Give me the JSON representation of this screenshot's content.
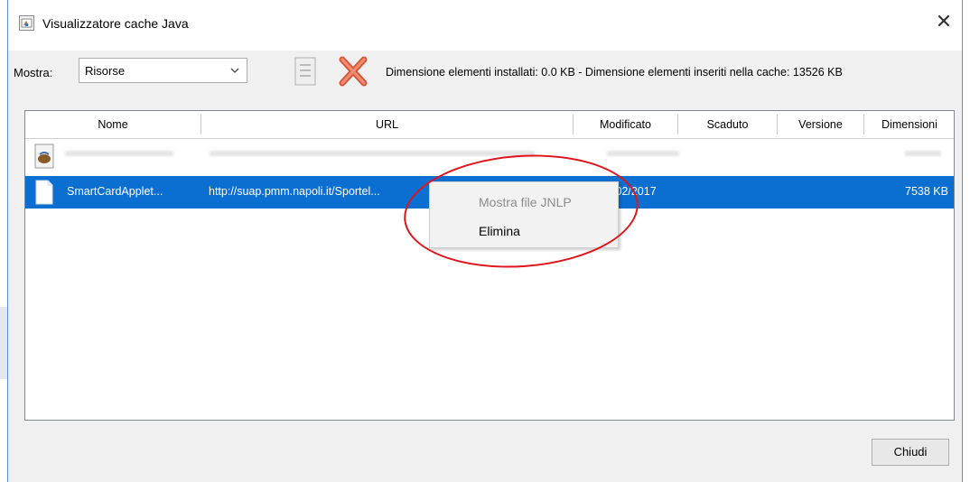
{
  "window": {
    "title": "Visualizzatore cache Java"
  },
  "toolbar": {
    "mostra_label": "Mostra:",
    "mostra_value": "Risorse",
    "info_text": "Dimensione elementi installati: 0.0 KB - Dimensione elementi inseriti nella cache: 13526 KB"
  },
  "table": {
    "columns": [
      "Nome",
      "URL",
      "Modificato",
      "Scaduto",
      "Versione",
      "Dimensioni"
    ],
    "rows": [
      {
        "nome": "SmartCardApplet...",
        "url": "http://suap.pmm.napoli.it/Sportel...",
        "modificato": "/02/2017",
        "scaduto": "",
        "versione": "",
        "dimensioni": "7538 KB",
        "selected": true
      }
    ]
  },
  "context_menu": {
    "items": [
      {
        "label": "Mostra file JNLP",
        "enabled": false
      },
      {
        "label": "Elimina",
        "enabled": true
      }
    ]
  },
  "footer": {
    "close_label": "Chiudi"
  },
  "colors": {
    "selection": "#0b6fd1",
    "annotation_ring": "#e0141b",
    "window_border": "#5b8fd6"
  },
  "icons": [
    "java-cache-icon",
    "close-icon",
    "chevron-down-icon",
    "document-list-icon",
    "delete-x-icon",
    "coffee-cup-icon",
    "file-icon"
  ]
}
